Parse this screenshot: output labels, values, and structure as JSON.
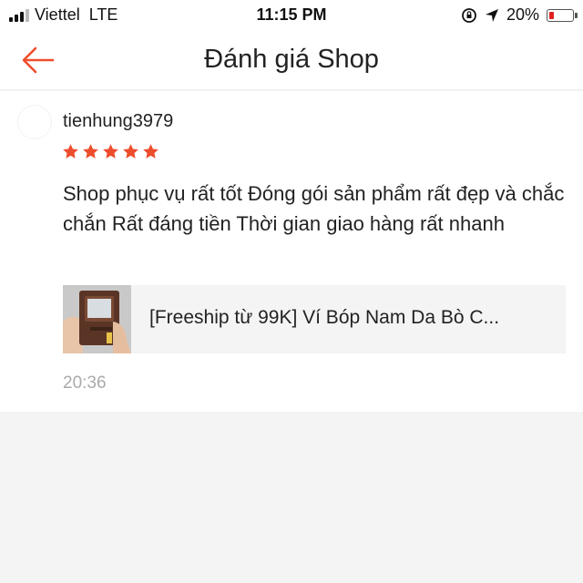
{
  "status_bar": {
    "carrier": "Viettel",
    "network": "LTE",
    "time": "11:15 PM",
    "battery_percent": "20%",
    "battery_level": 0.2,
    "icons": [
      "signal-bars-icon",
      "orientation-lock-icon",
      "location-arrow-icon",
      "battery-icon"
    ]
  },
  "nav": {
    "title": "Đánh giá Shop",
    "back_icon": "arrow-left-icon",
    "accent": "#ee4d2d"
  },
  "review": {
    "username": "tienhung3979",
    "rating": 5,
    "max_rating": 5,
    "star_color": "#ee4d2d",
    "text": "Shop phục vụ rất tốt Đóng gói sản phẩm rất đẹp và chắc chắn Rất đáng tiền Thời gian giao hàng rất nhanh",
    "product": {
      "title": "[Freeship từ 99K] Ví Bóp Nam Da Bò C..."
    },
    "time": "20:36"
  }
}
